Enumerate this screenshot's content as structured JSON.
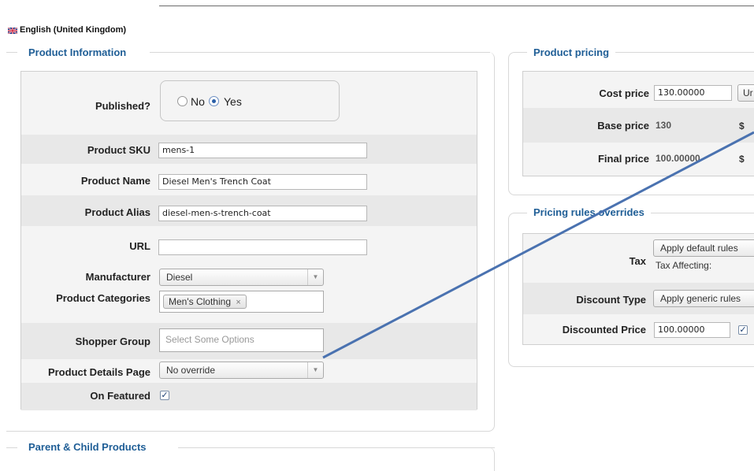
{
  "language": {
    "label": "English (United Kingdom)",
    "flag_icon": "uk-flag-icon"
  },
  "product_information": {
    "legend": "Product Information",
    "published": {
      "label": "Published?",
      "option_no": "No",
      "option_yes": "Yes",
      "selected": "Yes"
    },
    "sku": {
      "label": "Product SKU",
      "value": "mens-1"
    },
    "name": {
      "label": "Product Name",
      "value": "Diesel Men's Trench Coat"
    },
    "alias": {
      "label": "Product Alias",
      "value": "diesel-men-s-trench-coat"
    },
    "url": {
      "label": "URL",
      "value": ""
    },
    "manufacturer": {
      "label": "Manufacturer",
      "value": "Diesel"
    },
    "categories": {
      "label": "Product Categories",
      "chip": "Men's Clothing",
      "remove": "×"
    },
    "shopper_group": {
      "label": "Shopper Group",
      "placeholder": "Select Some Options"
    },
    "details_page": {
      "label": "Product Details Page",
      "value": "No override"
    },
    "featured": {
      "label": "On Featured",
      "checked": true
    }
  },
  "product_pricing": {
    "legend": "Product pricing",
    "cost_price": {
      "label": "Cost price",
      "value": "130.00000",
      "button": "Ur"
    },
    "base_price": {
      "label": "Base price",
      "value": "130",
      "currency": "$"
    },
    "final_price": {
      "label": "Final price",
      "value": "100.00000",
      "currency": "$"
    }
  },
  "pricing_rules": {
    "legend": "Pricing rules overrides",
    "tax": {
      "label": "Tax",
      "value": "Apply default rules",
      "note": "Tax Affecting:"
    },
    "discount_type": {
      "label": "Discount Type",
      "value": "Apply generic rules"
    },
    "discounted_price": {
      "label": "Discounted Price",
      "value": "100.00000",
      "checked": true
    }
  },
  "parent_child": {
    "legend": "Parent & Child Products"
  },
  "annotation": {
    "color": "#4a72b0"
  }
}
